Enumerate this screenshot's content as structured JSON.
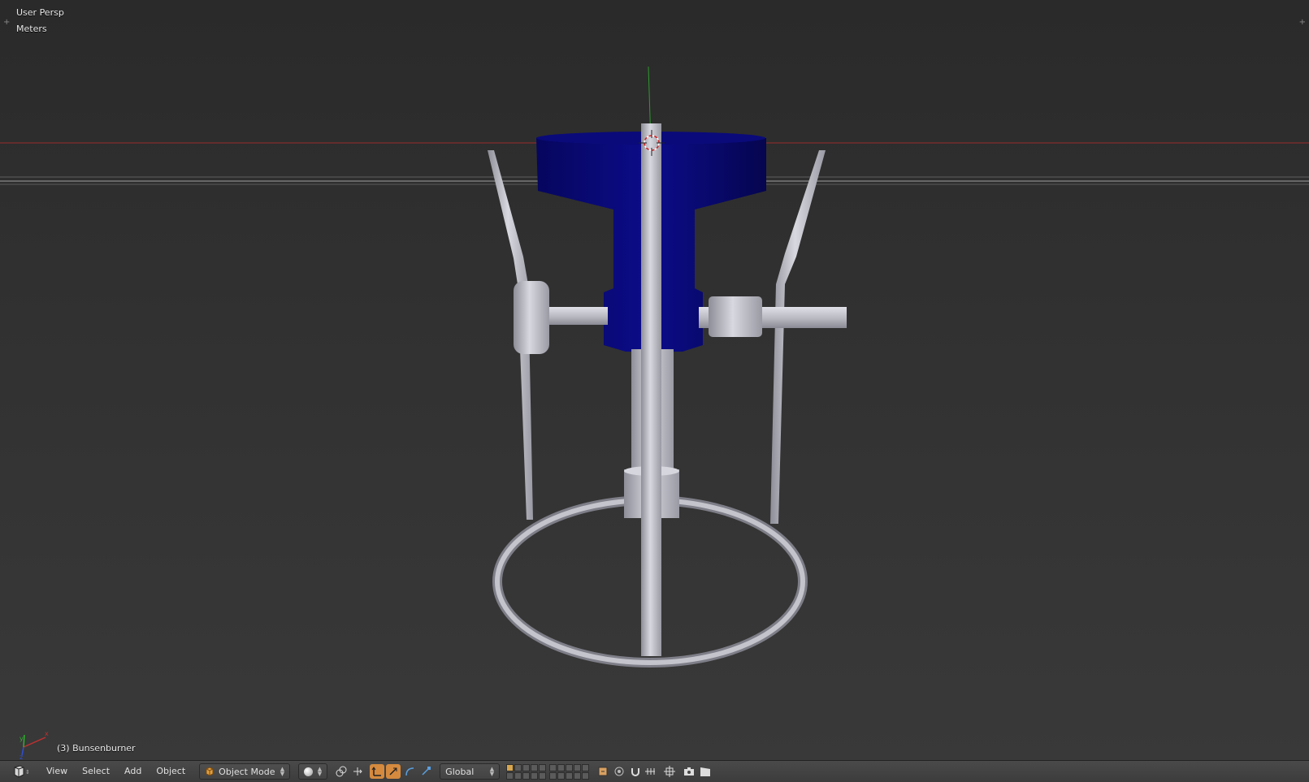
{
  "viewport": {
    "view_name": "User Persp",
    "units": "Meters",
    "object_label": "(3) Bunsenburner"
  },
  "header": {
    "menus": [
      "View",
      "Select",
      "Add",
      "Object"
    ],
    "mode": "Object Mode",
    "orientation": "Global"
  },
  "colors": {
    "viewport_bg": "#393939",
    "burner_blue": "#0a0a80",
    "metal": "#c8c8d0",
    "x_axis": "#b03030",
    "y_axis": "#30a030",
    "active_button": "#d58a3e"
  },
  "icons": {
    "editor_type": "3d-view-icon",
    "mode": "cube-icon",
    "shading": "sphere-icon",
    "pivot": "pivot-icon",
    "manipulator": "manipulator-icon",
    "snap": "magnet-icon",
    "render": "camera-icon"
  }
}
